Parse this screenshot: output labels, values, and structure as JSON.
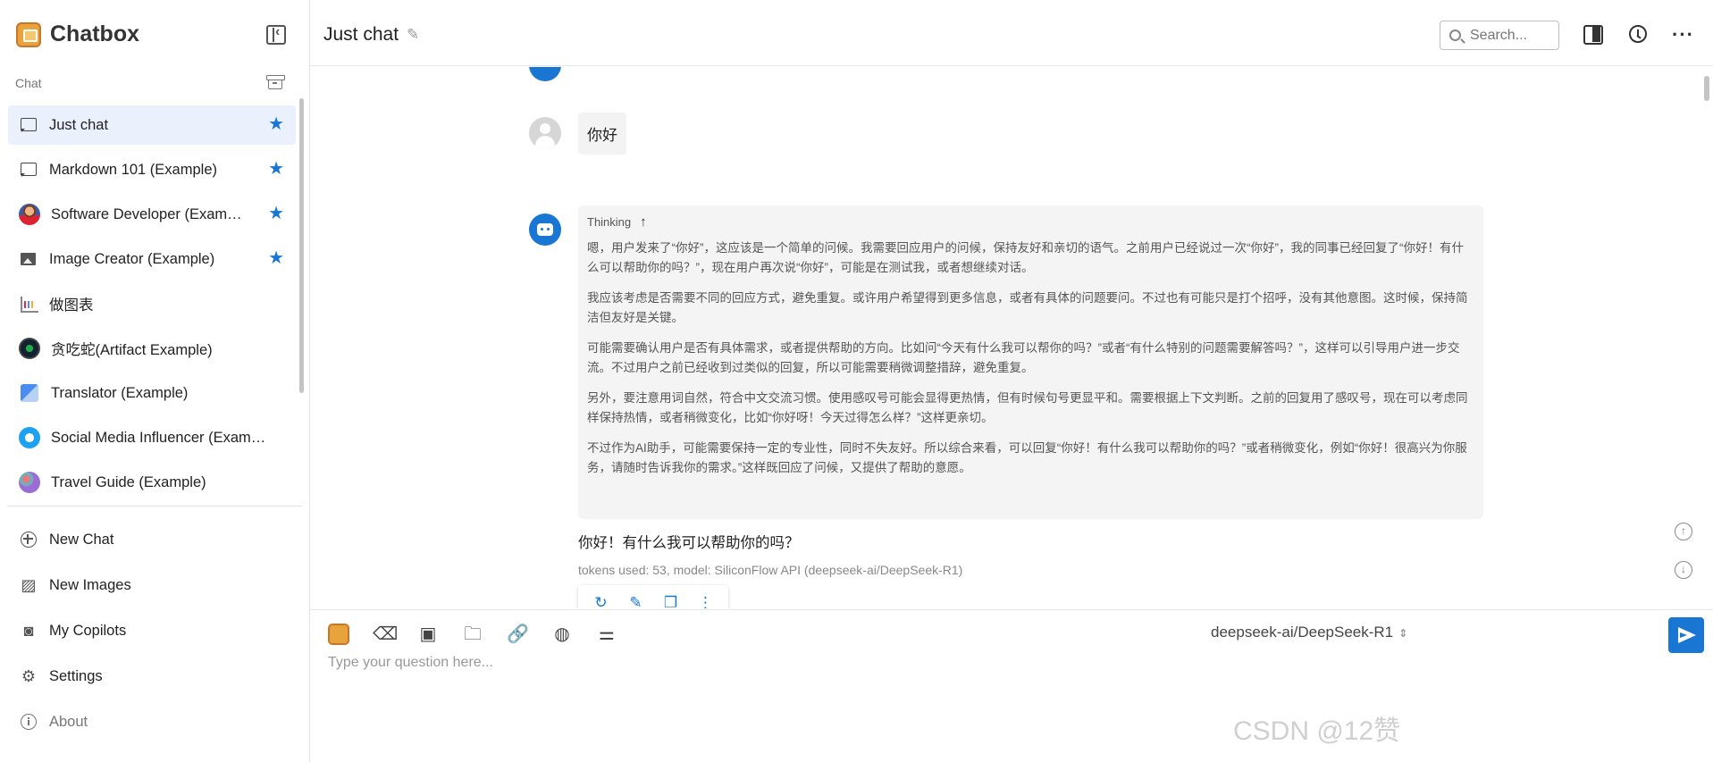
{
  "app": {
    "name": "Chatbox"
  },
  "sidebar": {
    "section_label": "Chat",
    "chats": [
      {
        "label": "Just chat",
        "starred": true,
        "active": true,
        "icon": "chat-bubble-icon"
      },
      {
        "label": "Markdown 101 (Example)",
        "starred": true,
        "icon": "chat-bubble-icon"
      },
      {
        "label": "Software Developer (Exam…",
        "starred": true,
        "icon": "developer-avatar-icon"
      },
      {
        "label": "Image Creator (Example)",
        "starred": true,
        "icon": "image-icon"
      },
      {
        "label": "做图表",
        "starred": false,
        "icon": "chart-icon"
      },
      {
        "label": "贪吃蛇(Artifact Example)",
        "starred": false,
        "icon": "snake-game-avatar-icon"
      },
      {
        "label": "Translator (Example)",
        "starred": false,
        "icon": "translator-avatar-icon"
      },
      {
        "label": "Social Media Influencer (Example)",
        "starred": false,
        "icon": "twitter-avatar-icon"
      },
      {
        "label": "Travel Guide (Example)",
        "starred": false,
        "icon": "globe-avatar-icon"
      }
    ],
    "nav": [
      {
        "label": "New Chat",
        "icon": "plus-circle-icon"
      },
      {
        "label": "New Images",
        "icon": "add-image-icon"
      },
      {
        "label": "My Copilots",
        "icon": "robot-icon"
      },
      {
        "label": "Settings",
        "icon": "gear-icon"
      },
      {
        "label": "About",
        "icon": "info-icon"
      }
    ]
  },
  "header": {
    "title": "Just chat",
    "search_placeholder": "Search..."
  },
  "conversation": {
    "user_message": "你好",
    "thinking_label": "Thinking",
    "thinking_paragraphs": [
      "嗯，用户发来了“你好”，这应该是一个简单的问候。我需要回应用户的问候，保持友好和亲切的语气。之前用户已经说过一次“你好”，我的同事已经回复了“你好！有什么可以帮助你的吗？”，现在用户再次说“你好”，可能是在测试我，或者想继续对话。",
      "我应该考虑是否需要不同的回应方式，避免重复。或许用户希望得到更多信息，或者有具体的问题要问。不过也有可能只是打个招呼，没有其他意图。这时候，保持简洁但友好是关键。",
      "可能需要确认用户是否有具体需求，或者提供帮助的方向。比如问“今天有什么我可以帮你的吗？”或者“有什么特别的问题需要解答吗？”，这样可以引导用户进一步交流。不过用户之前已经收到过类似的回复，所以可能需要稍微调整措辞，避免重复。",
      "另外，要注意用词自然，符合中文交流习惯。使用感叹号可能会显得更热情，但有时候句号更显平和。需要根据上下文判断。之前的回复用了感叹号，现在可以考虑同样保持热情，或者稍微变化，比如“你好呀！今天过得怎么样？”这样更亲切。",
      "不过作为AI助手，可能需要保持一定的专业性，同时不失友好。所以综合来看，可以回复“你好！有什么我可以帮助你的吗？”或者稍微变化，例如“你好！很高兴为你服务，请随时告诉我你的需求。”这样既回应了问候，又提供了帮助的意愿。"
    ],
    "answer": "你好！有什么我可以帮助你的吗？",
    "token_info": "tokens used: 53, model: SiliconFlow API (deepseek-ai/DeepSeek-R1)"
  },
  "composer": {
    "model": "deepseek-ai/DeepSeek-R1",
    "placeholder": "Type your question here..."
  },
  "watermark": "CSDN @12赞",
  "colors": {
    "accent": "#1976d2",
    "active_bg": "#eaf1fc",
    "thinking_bg": "#f4f4f4"
  }
}
